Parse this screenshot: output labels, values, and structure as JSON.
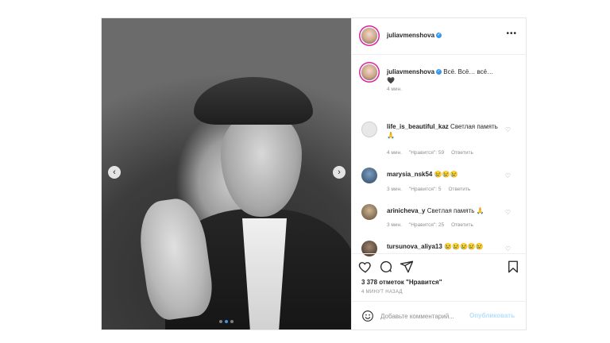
{
  "post": {
    "username": "juliavmenshova",
    "more_glyph": "•••"
  },
  "carousel": {
    "slide_count": 3,
    "active_index": 1,
    "prev_glyph": "‹",
    "next_glyph": "›"
  },
  "caption": {
    "username": "juliavmenshova",
    "text": "Всё. Всё… всё…",
    "emoji": "🖤",
    "time": "4 мин."
  },
  "comments": [
    {
      "username": "life_is_beautiful_kaz",
      "text": "Светлая память🙏",
      "time": "4 мин.",
      "likes": "\"Нравится\": 59",
      "reply": "Ответить",
      "avatar_color": "#e8e8e8"
    },
    {
      "username": "marysia_nsk54",
      "text": "😢😢😢",
      "time": "3 мин.",
      "likes": "\"Нравится\": 5",
      "reply": "Ответить",
      "avatar_color": "#3b5a7a"
    },
    {
      "username": "arinicheva_y",
      "text": "Светлая память 🙏",
      "time": "3 мин.",
      "likes": "\"Нравится\": 25",
      "reply": "Ответить",
      "avatar_color": "#7b6a52"
    },
    {
      "username": "tursunova_aliya13",
      "text": "😢😢😢😢😢",
      "time": "",
      "likes": "",
      "reply": "",
      "avatar_color": "#4a3a2e"
    }
  ],
  "actions": {
    "likes_text": "3 378 отметок \"Нравится\"",
    "post_time": "4 МИНУТ НАЗАД"
  },
  "add_comment": {
    "placeholder": "Добавьте комментарий...",
    "publish_label": "Опубликовать"
  },
  "colors": {
    "accent": "#3897f0",
    "text": "#262626",
    "muted": "#8e8e8e",
    "publish_disabled": "#b2dffc"
  }
}
